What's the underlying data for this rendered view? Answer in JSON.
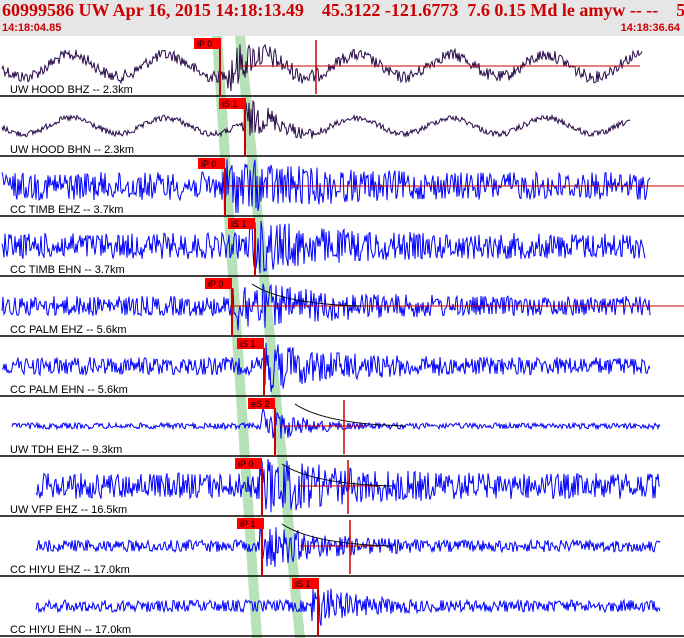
{
  "header": {
    "title": "60999586 UW Apr 16, 2015 14:18:13.49    45.3122 -121.6773  7.6 0.15 Md le amyw -- --    5",
    "start_time": "14:18:04.85",
    "end_time": "14:18:36.64"
  },
  "colors": {
    "header_bg": "#e6e6e6",
    "title": "#cc0000",
    "trace_uw_hood": "#2a0a4a",
    "trace_other": "#0000ff",
    "pick_label_bg": "#ff0000",
    "pick_line": "#cc0000",
    "window_band": "#9fd89f"
  },
  "traces": [
    {
      "label": "UW HOOD BHZ -- 2.3km",
      "pick": "iP 0",
      "color": "trace_uw_hood"
    },
    {
      "label": "UW HOOD BHN -- 2.3km",
      "pick": "iS 1",
      "color": "trace_uw_hood"
    },
    {
      "label": "CC TIMB EHZ -- 3.7km",
      "pick": "iP 0",
      "color": "trace_other"
    },
    {
      "label": "CC TIMB EHN -- 3.7km",
      "pick": "iS 1",
      "color": "trace_other"
    },
    {
      "label": "CC PALM EHZ -- 5.6km",
      "pick": "iP 0",
      "color": "trace_other"
    },
    {
      "label": "CC PALM EHN -- 5.6km",
      "pick": "iS 1",
      "color": "trace_other"
    },
    {
      "label": "UW TDH EHZ -- 9.3km",
      "pick": "eS 2",
      "color": "trace_other"
    },
    {
      "label": "UW VFP EHZ -- 16.5km",
      "pick": "iP 0",
      "color": "trace_other"
    },
    {
      "label": "CC HIYU EHZ -- 17.0km",
      "pick": "iP 1",
      "color": "trace_other"
    },
    {
      "label": "CC HIYU EHN -- 17.0km",
      "pick": "iS 1",
      "color": "trace_other"
    }
  ]
}
